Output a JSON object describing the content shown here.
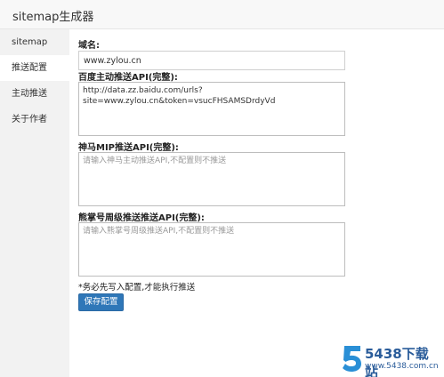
{
  "window": {
    "title": "sitemap生成器"
  },
  "sidebar": {
    "items": [
      {
        "label": "sitemap"
      },
      {
        "label": "推送配置"
      },
      {
        "label": "主动推送"
      },
      {
        "label": "关于作者"
      }
    ]
  },
  "form": {
    "domain": {
      "label": "域名:",
      "value": "www.zylou.cn"
    },
    "baidu_api": {
      "label": "百度主动推送API(完整):",
      "value": "http://data.zz.baidu.com/urls?\nsite=www.zylou.cn&token=vsucFHSAMSDrdyVd"
    },
    "shenma_api": {
      "label": "神马MIP推送API(完整):",
      "placeholder": "请输入神马主动推送API,不配置则不推送"
    },
    "xiongzhang_api": {
      "label": "熊掌号周级推送推送API(完整):",
      "placeholder": "请输入熊掌号周级推送API,不配置则不推送"
    },
    "note": "*务必先写入配置,才能执行推送",
    "save_label": "保存配置"
  },
  "watermark": {
    "brand": "5438下载站",
    "url": "www.5438.com.cn",
    "logo_char": "5"
  }
}
